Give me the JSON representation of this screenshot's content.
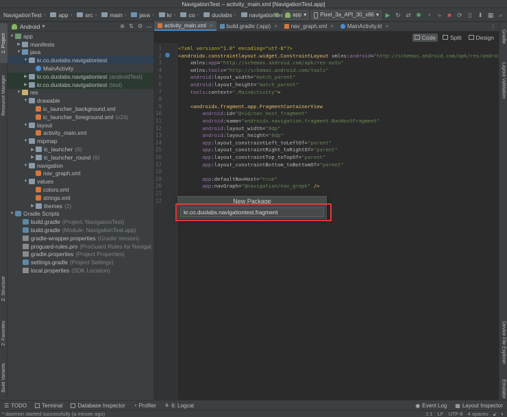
{
  "window": {
    "title": "NavigationTest – activity_main.xml [NavigationTest.app]"
  },
  "breadcrumb": [
    "NavigationTest",
    "app",
    "src",
    "main",
    "java",
    "kr",
    "co",
    "duolabs",
    "navigationtest"
  ],
  "run_toolbar": {
    "module": "app",
    "device": "Pixel_3a_API_30_x86"
  },
  "left_tools": {
    "project": "1: Project",
    "resource_manager": "Resource Manager",
    "structure": "Z: Structure",
    "favorites": "2: Favorites",
    "build_variants": "Build Variants"
  },
  "right_tools": {
    "gradle": "Gradle",
    "layout_validation": "Layout Validation",
    "device_file_explorer": "Device File Explorer",
    "emulator": "Emulator"
  },
  "project_panel": {
    "view_mode": "Android",
    "tree": [
      {
        "label": "app",
        "note": ""
      },
      {
        "label": "manifests",
        "note": ""
      },
      {
        "label": "java",
        "note": ""
      },
      {
        "label": "kr.co.duolabs.navigationtest",
        "note": ""
      },
      {
        "label": "MainActivity",
        "note": ""
      },
      {
        "label": "kr.co.duolabs.navigationtest",
        "note": "(androidTest)"
      },
      {
        "label": "kr.co.duolabs.navigationtest",
        "note": "(test)"
      },
      {
        "label": "res",
        "note": ""
      },
      {
        "label": "drawable",
        "note": ""
      },
      {
        "label": "ic_launcher_background.xml",
        "note": ""
      },
      {
        "label": "ic_launcher_foreground.xml",
        "note": "(v24)"
      },
      {
        "label": "layout",
        "note": ""
      },
      {
        "label": "activity_main.xml",
        "note": ""
      },
      {
        "label": "mipmap",
        "note": ""
      },
      {
        "label": "ic_launcher",
        "note": "(6)"
      },
      {
        "label": "ic_launcher_round",
        "note": "(6)"
      },
      {
        "label": "navigation",
        "note": ""
      },
      {
        "label": "nav_graph.xml",
        "note": ""
      },
      {
        "label": "values",
        "note": ""
      },
      {
        "label": "colors.xml",
        "note": ""
      },
      {
        "label": "strings.xml",
        "note": ""
      },
      {
        "label": "themes",
        "note": "(2)"
      },
      {
        "label": "Gradle Scripts",
        "note": ""
      },
      {
        "label": "build.gradle",
        "note": "(Project: NavigationTest)"
      },
      {
        "label": "build.gradle",
        "note": "(Module: NavigationTest.app)"
      },
      {
        "label": "gradle-wrapper.properties",
        "note": "(Gradle Version)"
      },
      {
        "label": "proguard-rules.pro",
        "note": "(ProGuard Rules for Navigat"
      },
      {
        "label": "gradle.properties",
        "note": "(Project Properties)"
      },
      {
        "label": "settings.gradle",
        "note": "(Project Settings)"
      },
      {
        "label": "local.properties",
        "note": "(SDK Location)"
      }
    ]
  },
  "editor_tabs": [
    {
      "label": "activity_main.xml"
    },
    {
      "label": "build.gradle (:app)"
    },
    {
      "label": "nav_graph.xml"
    },
    {
      "label": "MainActivity.kt"
    }
  ],
  "editor_modes": {
    "code": "Code",
    "split": "Split",
    "design": "Design"
  },
  "code_lines": [
    {
      "n": "1",
      "parts": [
        {
          "c": "t-pi",
          "t": "<?xml version=\"1.0\" encoding=\"utf-8\"?>"
        }
      ]
    },
    {
      "n": "2",
      "parts": [
        {
          "c": "t-tag",
          "t": "<androidx.constraintlayout.widget.ConstraintLayout "
        },
        {
          "c": "t-attr",
          "t": "xmlns:"
        },
        {
          "c": "t-ns",
          "t": "android"
        },
        {
          "c": "t-attr",
          "t": "="
        },
        {
          "c": "t-val",
          "t": "\"http://schemas.android.com/apk/res/android\""
        }
      ]
    },
    {
      "n": "3",
      "parts": [
        {
          "c": "t-attr",
          "t": "    xmlns:"
        },
        {
          "c": "t-ns",
          "t": "app"
        },
        {
          "c": "t-attr",
          "t": "="
        },
        {
          "c": "t-val",
          "t": "\"http://schemas.android.com/apk/res-auto\""
        }
      ]
    },
    {
      "n": "4",
      "parts": [
        {
          "c": "t-attr",
          "t": "    xmlns:"
        },
        {
          "c": "t-ns",
          "t": "tools"
        },
        {
          "c": "t-attr",
          "t": "="
        },
        {
          "c": "t-val",
          "t": "\"http://schemas.android.com/tools\""
        }
      ]
    },
    {
      "n": "5",
      "parts": [
        {
          "c": "t-ns",
          "t": "    android"
        },
        {
          "c": "t-attr",
          "t": ":layout_width="
        },
        {
          "c": "t-val",
          "t": "\"match_parent\""
        }
      ]
    },
    {
      "n": "6",
      "parts": [
        {
          "c": "t-ns",
          "t": "    android"
        },
        {
          "c": "t-attr",
          "t": ":layout_height="
        },
        {
          "c": "t-val",
          "t": "\"match_parent\""
        }
      ]
    },
    {
      "n": "7",
      "parts": [
        {
          "c": "t-ns",
          "t": "    tools"
        },
        {
          "c": "t-attr",
          "t": ":context="
        },
        {
          "c": "t-val",
          "t": "\".MainActivity\""
        },
        {
          "c": "t-tag",
          "t": ">"
        }
      ]
    },
    {
      "n": "8",
      "parts": []
    },
    {
      "n": "9",
      "parts": [
        {
          "c": "t-tag",
          "t": "    <androidx.fragment.app.FragmentContainerView"
        }
      ]
    },
    {
      "n": "10",
      "parts": [
        {
          "c": "t-ns",
          "t": "        android"
        },
        {
          "c": "t-attr",
          "t": ":id="
        },
        {
          "c": "t-val",
          "t": "\"@+id/nav_host_fragment\""
        }
      ]
    },
    {
      "n": "11",
      "parts": [
        {
          "c": "t-ns",
          "t": "        android"
        },
        {
          "c": "t-attr",
          "t": ":name="
        },
        {
          "c": "t-val",
          "t": "\"androidx.navigation.fragment.NavHostFragment\""
        }
      ]
    },
    {
      "n": "12",
      "parts": [
        {
          "c": "t-ns",
          "t": "        android"
        },
        {
          "c": "t-attr",
          "t": ":layout_width="
        },
        {
          "c": "t-val",
          "t": "\"0dp\""
        }
      ]
    },
    {
      "n": "13",
      "parts": [
        {
          "c": "t-ns",
          "t": "        android"
        },
        {
          "c": "t-attr",
          "t": ":layout_height="
        },
        {
          "c": "t-val",
          "t": "\"0dp\""
        }
      ]
    },
    {
      "n": "14",
      "parts": [
        {
          "c": "t-ns",
          "t": "        app"
        },
        {
          "c": "t-attr",
          "t": ":layout_constraintLeft_toLeftOf="
        },
        {
          "c": "t-val",
          "t": "\"parent\""
        }
      ]
    },
    {
      "n": "15",
      "parts": [
        {
          "c": "t-ns",
          "t": "        app"
        },
        {
          "c": "t-attr",
          "t": ":layout_constraintRight_toRightOf="
        },
        {
          "c": "t-val",
          "t": "\"parent\""
        }
      ]
    },
    {
      "n": "16",
      "parts": [
        {
          "c": "t-ns",
          "t": "        app"
        },
        {
          "c": "t-attr",
          "t": ":layout_constraintTop_toTopOf="
        },
        {
          "c": "t-val",
          "t": "\"parent\""
        }
      ]
    },
    {
      "n": "17",
      "parts": [
        {
          "c": "t-ns",
          "t": "        app"
        },
        {
          "c": "t-attr",
          "t": ":layout_constraintBottom_toBottomOf="
        },
        {
          "c": "t-val",
          "t": "\"parent\""
        }
      ]
    },
    {
      "n": "18",
      "parts": []
    },
    {
      "n": "19",
      "parts": [
        {
          "c": "t-ns",
          "t": "        app"
        },
        {
          "c": "t-attr",
          "t": ":defaultNavHost="
        },
        {
          "c": "t-val",
          "t": "\"true\""
        }
      ]
    },
    {
      "n": "20",
      "parts": [
        {
          "c": "t-ns",
          "t": "        app"
        },
        {
          "c": "t-attr",
          "t": ":navGraph="
        },
        {
          "c": "t-val",
          "t": "\"@navigation/nav_graph\""
        },
        {
          "c": "t-tag",
          "t": " />"
        }
      ]
    },
    {
      "n": "21",
      "parts": []
    },
    {
      "n": "22",
      "parts": []
    }
  ],
  "new_package_popup": {
    "title": "New Package",
    "value": "kr.co.duolabs.navigationtest.fragment"
  },
  "bottom_tools": {
    "todo": "TODO",
    "terminal": "Terminal",
    "database_inspector": "Database Inspector",
    "profiler": "Profiler",
    "logcat": "6: Logcat",
    "event_log": "Event Log",
    "layout_inspector": "Layout Inspector"
  },
  "status": {
    "message": "* daemon started successfully (a minute ago)",
    "position": "1:1",
    "line_sep": "LF",
    "encoding": "UTF-8",
    "indent": "4 spaces"
  },
  "colors": {
    "selection": "#2f3f52",
    "highlight": "#e53935",
    "tab_underline": "#4a88c7"
  }
}
